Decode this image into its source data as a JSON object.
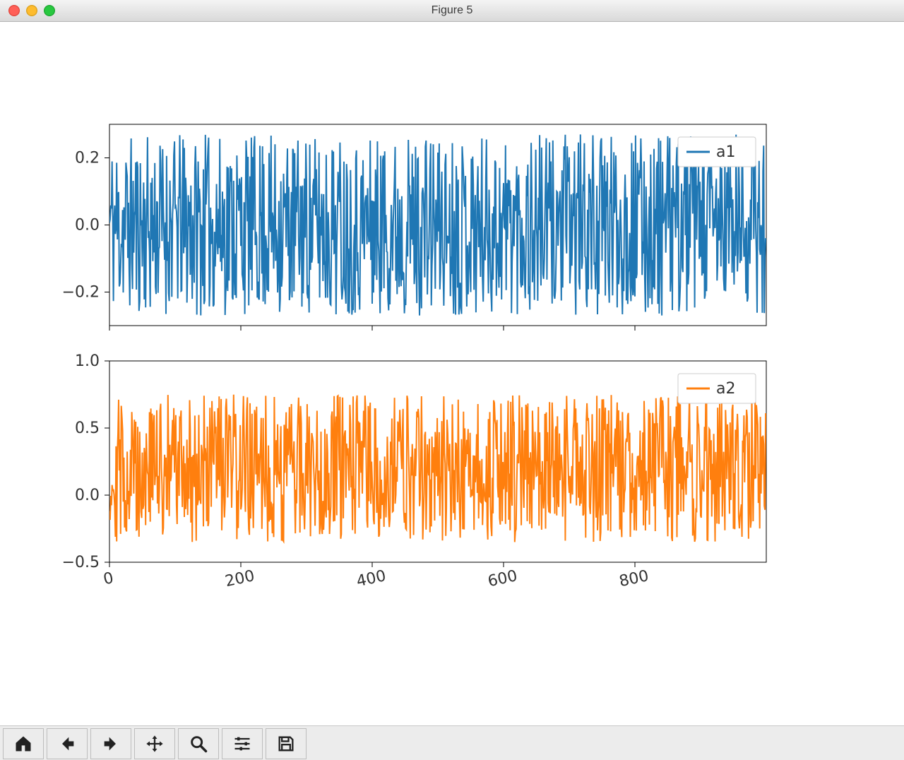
{
  "window": {
    "title": "Figure 5"
  },
  "toolbar": {
    "home": "Home",
    "back": "Back",
    "forward": "Forward",
    "pan": "Pan",
    "zoom": "Zoom",
    "config": "Configure subplots",
    "save": "Save"
  },
  "chart_data": [
    {
      "type": "line",
      "title": "",
      "xlabel": "",
      "ylabel": "",
      "xlim": [
        0,
        1000
      ],
      "ylim": [
        -0.3,
        0.3
      ],
      "xticks": [
        0,
        200,
        400,
        600,
        800
      ],
      "yticks": [
        -0.2,
        0.0,
        0.2
      ],
      "legend": {
        "position": "upper right",
        "entries": [
          "a1"
        ]
      },
      "series": [
        {
          "name": "a1",
          "color": "#1f77b4",
          "n": 1000,
          "mean": 0.0,
          "amp": 0.27,
          "seed": 11,
          "note": "dense noise series; values appear uniformly distributed roughly in [-0.28,0.28] centered at 0"
        }
      ]
    },
    {
      "type": "line",
      "title": "",
      "xlabel": "",
      "ylabel": "",
      "xlim": [
        0,
        1000
      ],
      "ylim": [
        -0.5,
        1.0
      ],
      "xticks": [
        0,
        200,
        400,
        600,
        800
      ],
      "yticks": [
        -0.5,
        0.0,
        0.5,
        1.0
      ],
      "legend": {
        "position": "upper right",
        "entries": [
          "a2"
        ]
      },
      "series": [
        {
          "name": "a2",
          "color": "#ff7f0e",
          "n": 1000,
          "mean": 0.2,
          "amp": 0.55,
          "seed": 29,
          "note": "dense noise series; values roughly in [-0.45,0.95] centered near 0.2"
        }
      ]
    }
  ]
}
